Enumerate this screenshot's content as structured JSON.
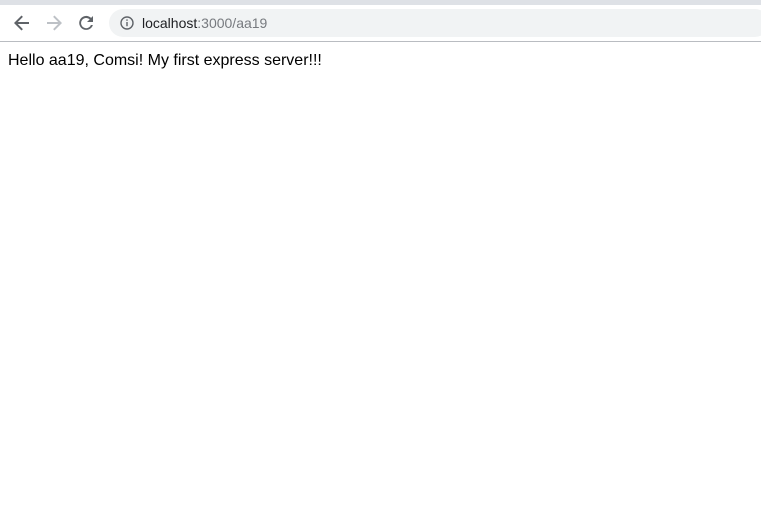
{
  "browser": {
    "url_host": "localhost",
    "url_path": ":3000/aa19",
    "icons": {
      "back": "back-arrow-icon",
      "forward": "forward-arrow-icon",
      "reload": "reload-icon",
      "info": "info-icon"
    }
  },
  "page": {
    "message": "Hello aa19, Comsi! My first express server!!!"
  },
  "colors": {
    "tab_strip": "#dee1e6",
    "omnibox_bg": "#f1f3f4",
    "icon_active": "#5f6368",
    "icon_disabled": "#bdc1c6",
    "url_path": "#777a7f"
  }
}
